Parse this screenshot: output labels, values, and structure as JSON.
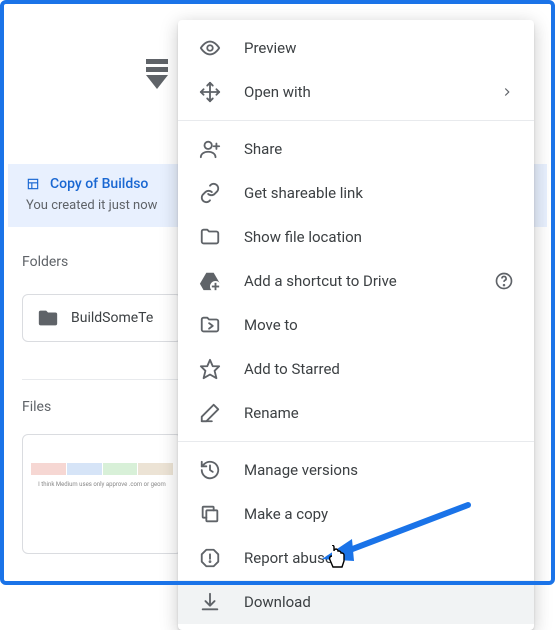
{
  "banner": {
    "title": "Copy of Buildso",
    "subtitle": "You created it just now"
  },
  "sections": {
    "folders_label": "Folders",
    "files_label": "Files"
  },
  "folder": {
    "name": "BuildSomeTe"
  },
  "file_thumb_caption": "I think Medium uses only approve .com or geom",
  "menu": {
    "groups": [
      [
        {
          "icon": "eye-icon",
          "label": "Preview",
          "submenu": false
        },
        {
          "icon": "move-arrows-icon",
          "label": "Open with",
          "submenu": true
        }
      ],
      [
        {
          "icon": "person-add-icon",
          "label": "Share",
          "submenu": false
        },
        {
          "icon": "link-icon",
          "label": "Get shareable link",
          "submenu": false
        },
        {
          "icon": "folder-outline-icon",
          "label": "Show file location",
          "submenu": false
        },
        {
          "icon": "drive-add-icon",
          "label": "Add a shortcut to Drive",
          "submenu": false,
          "help": true
        },
        {
          "icon": "folder-move-icon",
          "label": "Move to",
          "submenu": false
        },
        {
          "icon": "star-outline-icon",
          "label": "Add to Starred",
          "submenu": false
        },
        {
          "icon": "rename-icon",
          "label": "Rename",
          "submenu": false
        }
      ],
      [
        {
          "icon": "history-icon",
          "label": "Manage versions",
          "submenu": false
        },
        {
          "icon": "copy-icon",
          "label": "Make a copy",
          "submenu": false
        },
        {
          "icon": "report-icon",
          "label": "Report abuse",
          "submenu": false
        },
        {
          "icon": "download-icon",
          "label": "Download",
          "submenu": false,
          "hovered": true
        }
      ]
    ]
  }
}
